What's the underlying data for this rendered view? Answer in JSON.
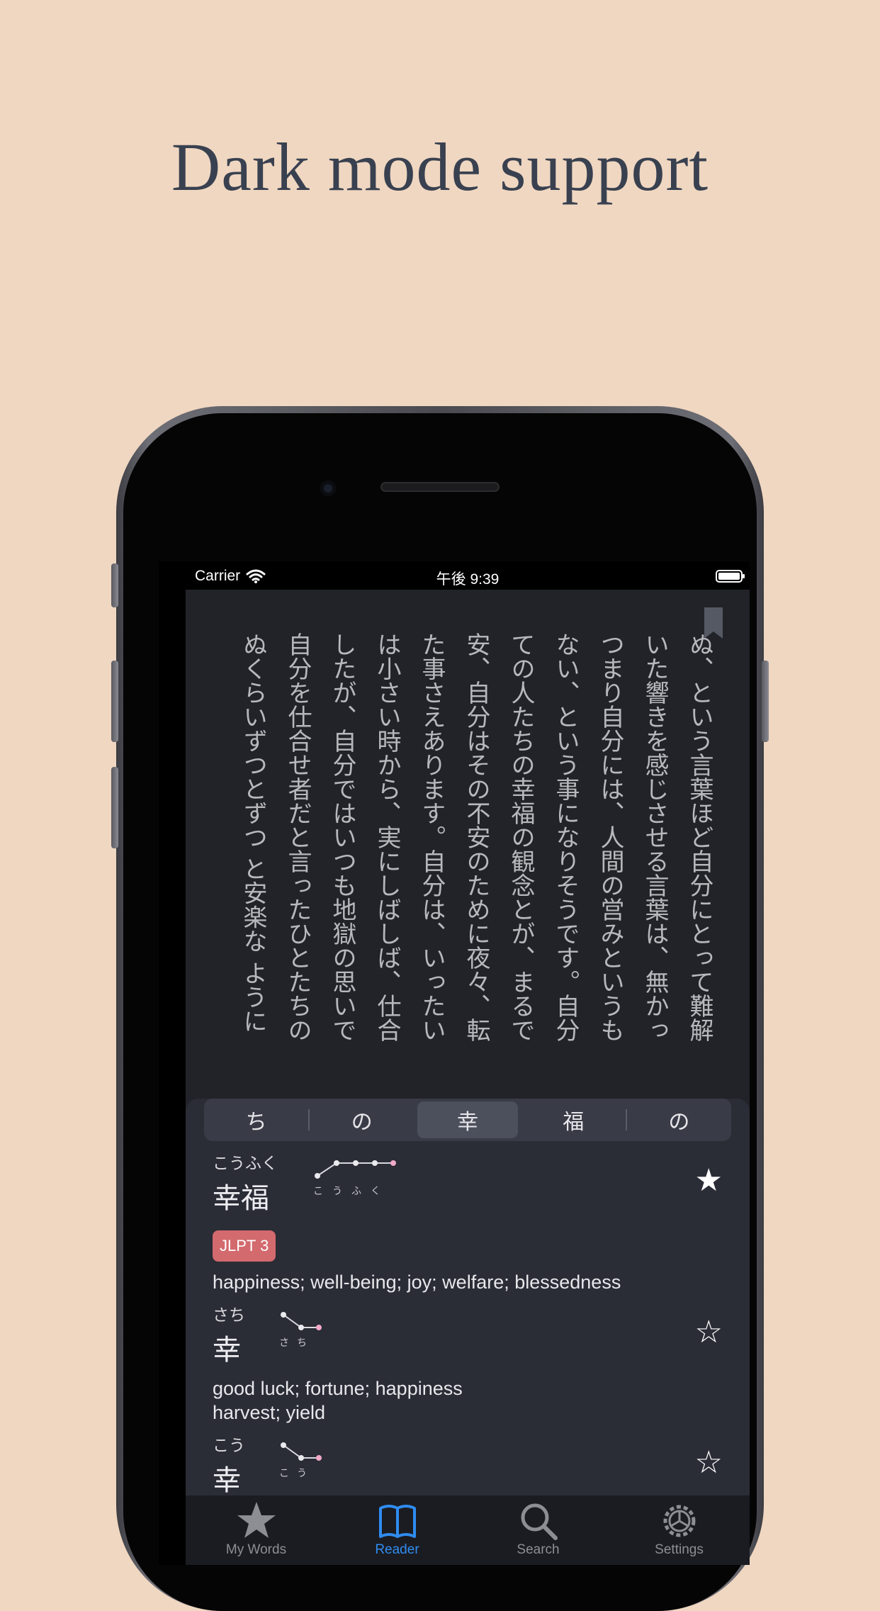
{
  "headline": "Dark mode support",
  "status_bar": {
    "carrier": "Carrier",
    "time": "午後 9:39"
  },
  "reader": {
    "columns": [
      "ぬ、という言葉ほど自分にとって難解",
      "いた響きを感じさせる言葉は、無かっ",
      "つまり自分には、人間の営みというも",
      "ない、という事になりそうです。自分",
      "ての人たちの幸福の観念とが、まるで",
      "安、自分はその不安のために夜々、転",
      "た事さえあります。自分は、いったい",
      "は小さい時から、実にしばしば、仕合",
      "したが、自分ではいつも地獄の思いで",
      "自分を仕合せ者だと言ったひとたちの",
      "ぬくらいずつとずつ と安楽な ように"
    ]
  },
  "dictionary": {
    "segments": [
      "ち",
      "の",
      "幸",
      "福",
      "の"
    ],
    "selected_index": 2,
    "entries": [
      {
        "reading": "こうふく",
        "kanji": "幸福",
        "pitch_kana": [
          "こ",
          "う",
          "ふ",
          "く"
        ],
        "starred": true,
        "badge": "JLPT 3",
        "glosses": [
          "happiness; well-being; joy; welfare; blessedness"
        ]
      },
      {
        "reading": "さち",
        "kanji": "幸",
        "pitch_kana": [
          "さ",
          "ち"
        ],
        "starred": false,
        "glosses": [
          "good luck; fortune; happiness",
          "harvest; yield"
        ]
      },
      {
        "reading": "こう",
        "kanji": "幸",
        "pitch_kana": [
          "こ",
          "う"
        ],
        "starred": false,
        "glosses": []
      }
    ],
    "star_filled": "★",
    "star_empty": "☆"
  },
  "tabs": [
    {
      "label": "My Words",
      "icon": "star-icon",
      "active": false
    },
    {
      "label": "Reader",
      "icon": "book-icon",
      "active": true
    },
    {
      "label": "Search",
      "icon": "search-icon",
      "active": false
    },
    {
      "label": "Settings",
      "icon": "gear-icon",
      "active": false
    }
  ],
  "colors": {
    "background": "#f0d7c1",
    "app_bg": "#212329",
    "accent": "#2f8cf0",
    "jlpt_badge": "#d36a6e"
  }
}
